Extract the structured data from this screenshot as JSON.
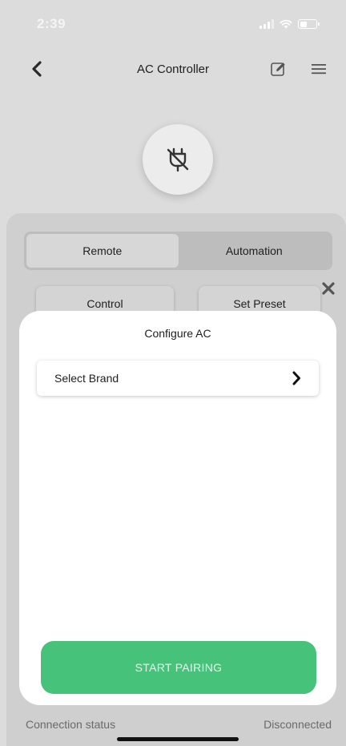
{
  "status_bar": {
    "time": "2:39"
  },
  "nav": {
    "title": "AC Controller"
  },
  "tabs": [
    {
      "label": "Remote",
      "active": true
    },
    {
      "label": "Automation",
      "active": false
    }
  ],
  "sub_buttons": {
    "control": "Control",
    "set_preset": "Set Preset"
  },
  "modal": {
    "title": "Configure AC",
    "select_brand": "Select Brand",
    "start_button": "START PAIRING"
  },
  "footer": {
    "connection_label": "Connection status",
    "connection_value": "Disconnected"
  },
  "colors": {
    "accent": "#46c27b",
    "background": "#dcdcdc",
    "modal": "#ffffff"
  },
  "icons": {
    "back": "chevron-left-icon",
    "edit": "edit-icon",
    "menu": "hamburger-menu-icon",
    "device": "plug-off-icon",
    "close": "close-icon",
    "brand_chevron": "chevron-right-icon"
  }
}
